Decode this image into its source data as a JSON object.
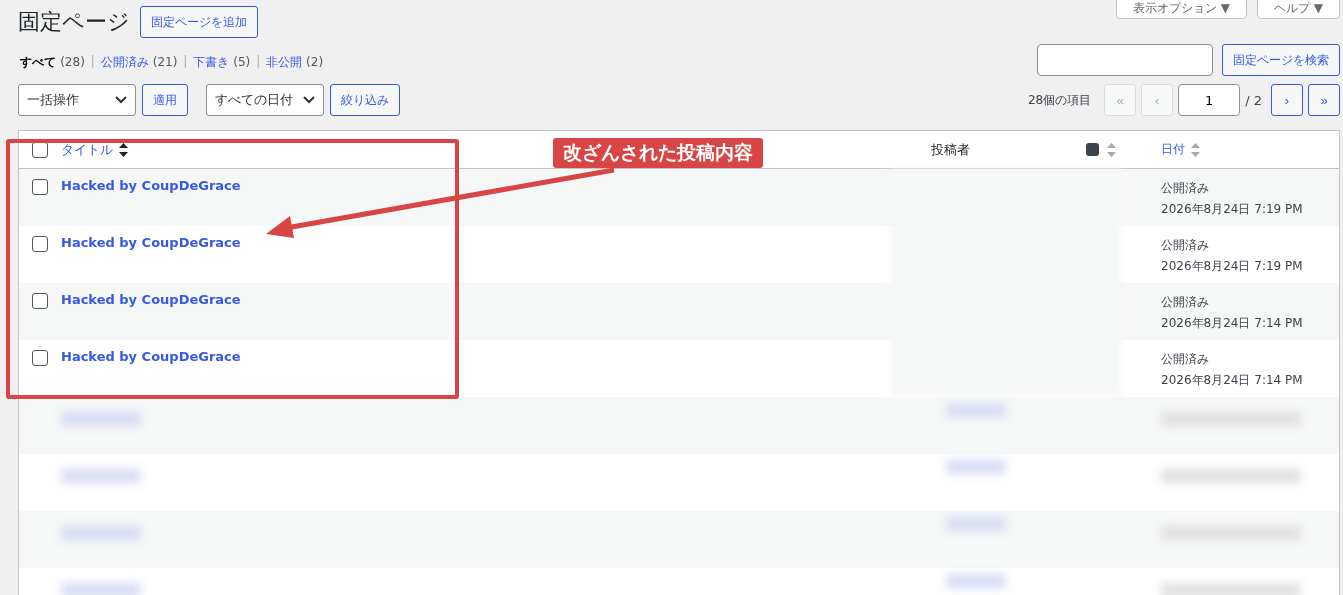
{
  "header_buttons": [
    {
      "label": "表示オプション ▼"
    },
    {
      "label": "ヘルプ ▼"
    }
  ],
  "page_title": "固定ページ",
  "add_button": "固定ページを追加",
  "status_filters": [
    {
      "label": "すべて",
      "count": "(28)",
      "selected": true
    },
    {
      "separator": "|",
      "label": "公開済み",
      "count": "(21)",
      "selected": false
    },
    {
      "separator": "|",
      "label": "下書き",
      "count": "(5)",
      "selected": false
    },
    {
      "separator": "|",
      "label": "非公開",
      "count": "(2)",
      "selected": false
    }
  ],
  "search": {
    "button": "固定ページを検索"
  },
  "bulk_action": {
    "value": "一括操作",
    "apply": "適用"
  },
  "date_filter": {
    "value": "すべての日付",
    "button": "絞り込み"
  },
  "pagination": {
    "count": "28個の項目",
    "page": "1",
    "total": "/ 2",
    "before": [
      {
        "label": "«",
        "disabled": true
      },
      {
        "label": "‹",
        "disabled": true
      }
    ],
    "after": [
      {
        "label": "›",
        "disabled": false
      },
      {
        "label": "»",
        "disabled": false
      }
    ]
  },
  "table": {
    "select_all_checked": false,
    "columns": {
      "title": "タイトル",
      "author": "投稿者",
      "date": "日付"
    },
    "rows": [
      {
        "checked": false,
        "title": "Hacked by CoupDeGrace",
        "status": "公開済み",
        "date": "2026年8月24日 7:19 PM"
      },
      {
        "checked": false,
        "title": "Hacked by CoupDeGrace",
        "status": "公開済み",
        "date": "2026年8月24日 7:19 PM"
      },
      {
        "checked": false,
        "title": "Hacked by CoupDeGrace",
        "status": "公開済み",
        "date": "2026年8月24日 7:14 PM"
      },
      {
        "checked": false,
        "title": "Hacked by CoupDeGrace",
        "status": "公開済み",
        "date": "2026年8月24日 7:14 PM"
      }
    ]
  },
  "annotation": {
    "label": "改ざんされた投稿内容"
  }
}
